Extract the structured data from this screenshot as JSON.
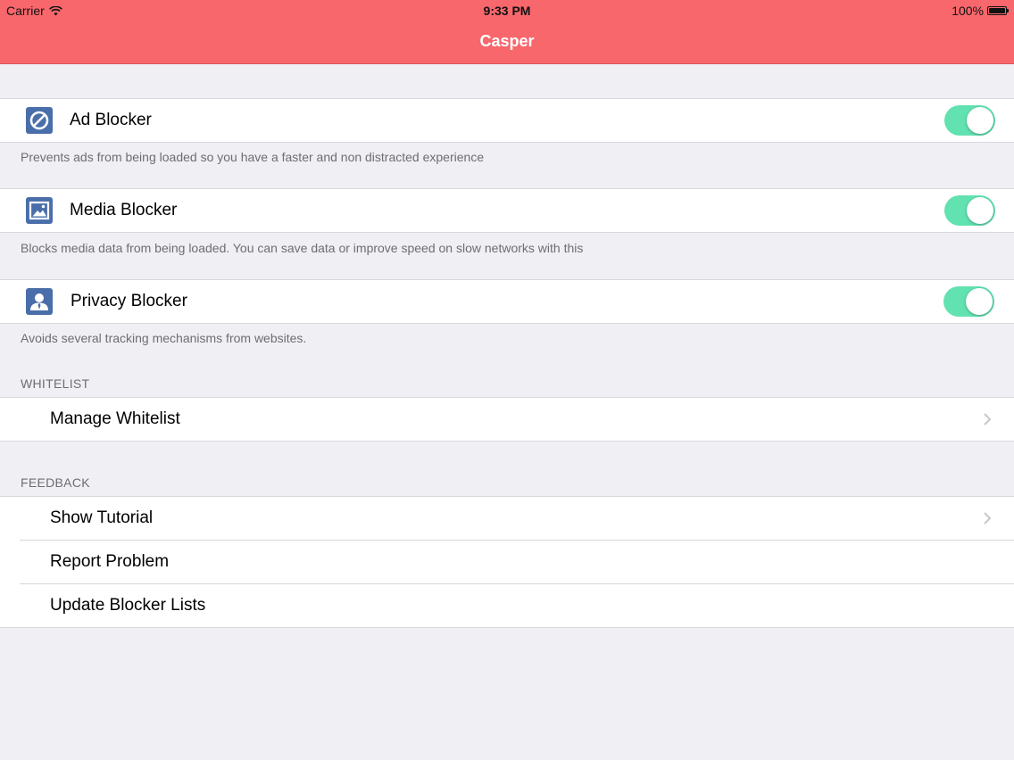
{
  "status_bar": {
    "carrier": "Carrier",
    "time": "9:33 PM",
    "battery": "100%"
  },
  "nav": {
    "title": "Casper",
    "background": "#f8676c"
  },
  "blockers": [
    {
      "label": "Ad Blocker",
      "icon": "prohibited-icon",
      "enabled": true,
      "description": "Prevents ads from being loaded so you have a faster and non distracted experience"
    },
    {
      "label": "Media Blocker",
      "icon": "image-icon",
      "enabled": true,
      "description": "Blocks media data from being loaded. You can save data or improve speed on slow networks with this"
    },
    {
      "label": "Privacy Blocker",
      "icon": "person-icon",
      "enabled": true,
      "description": "Avoids several tracking mechanisms from websites."
    }
  ],
  "whitelist": {
    "header": "WHITELIST",
    "items": [
      {
        "label": "Manage Whitelist",
        "chevron": true
      }
    ]
  },
  "feedback": {
    "header": "FEEDBACK",
    "items": [
      {
        "label": "Show Tutorial",
        "chevron": true
      },
      {
        "label": "Report Problem",
        "chevron": false
      },
      {
        "label": "Update Blocker Lists",
        "chevron": false
      }
    ]
  },
  "colors": {
    "toggle_on": "#62e2b0",
    "icon_tile": "#4a6ea9",
    "background": "#efeff4"
  }
}
